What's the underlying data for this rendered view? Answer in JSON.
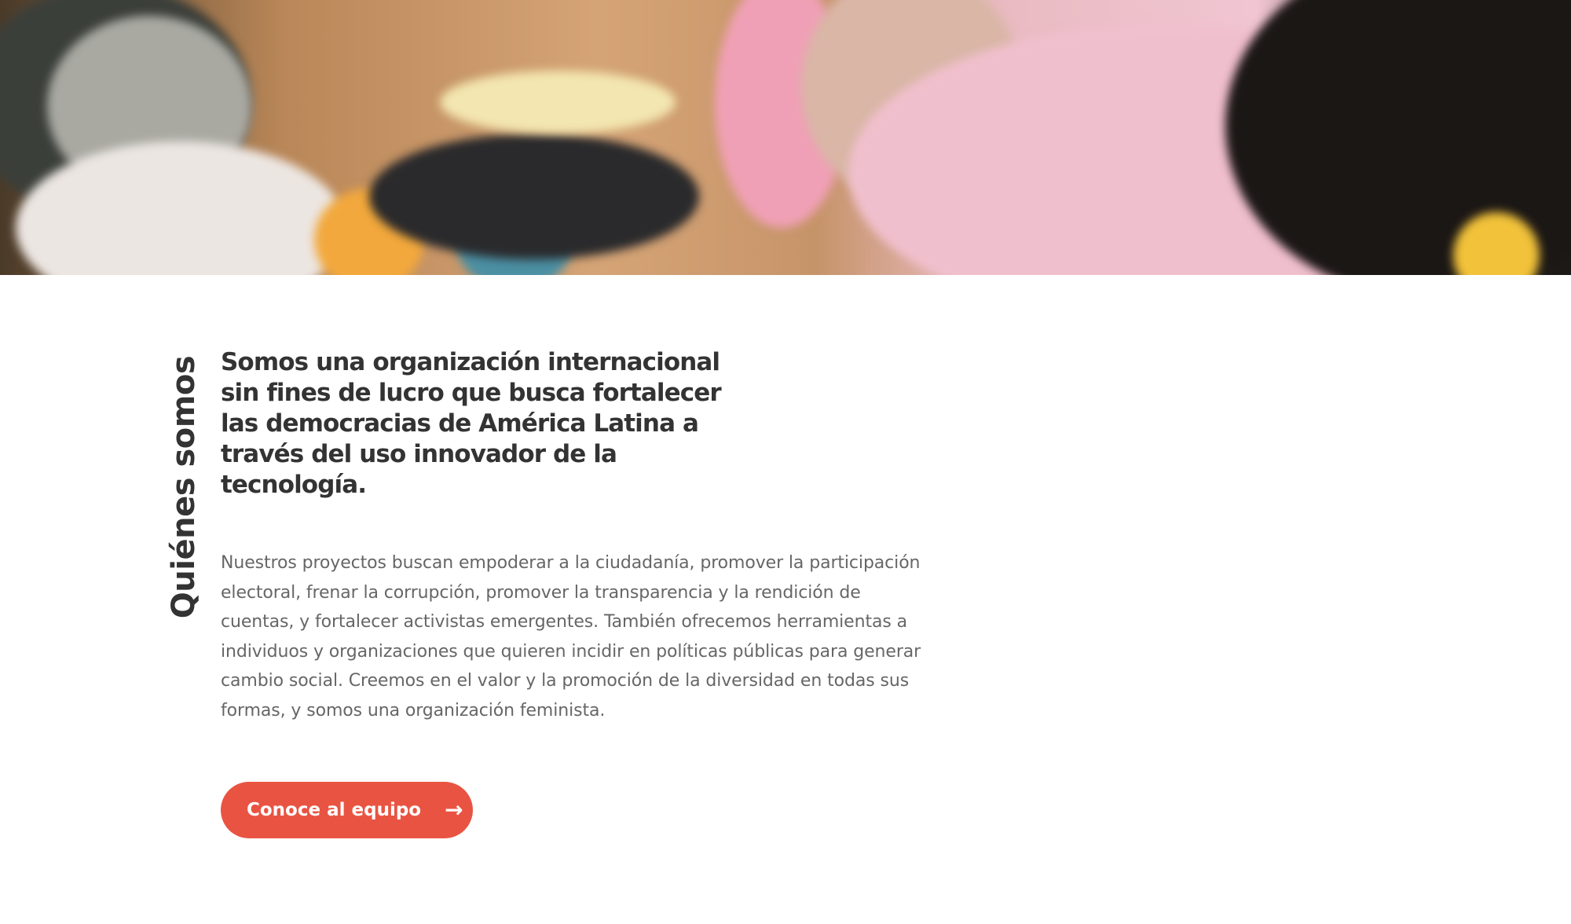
{
  "hero": {
    "image_alt": "photo-of-people-working-at-table"
  },
  "about": {
    "section_title": "Quiénes somos",
    "headline": "Somos una organización internacional sin fines de lucro que busca fortalecer las democracias de América Latina a través del uso innovador de la tecnología.",
    "body": "Nuestros proyectos buscan empoderar a la ciudadanía, promover la participación electoral, frenar la corrupción, promover la transparencia y la rendición de cuentas, y fortalecer activistas emergentes. También ofrecemos herramientas a individuos y organizaciones que quieren incidir en políticas públicas para generar cambio social. Creemos en el valor y la promoción de la diversidad en todas sus formas, y somos una organización feminista.",
    "cta_label": "Conoce al equipo",
    "cta_icon": "arrow-right-icon"
  },
  "colors": {
    "accent": "#e95442",
    "heading": "#333333",
    "body": "#666666"
  }
}
